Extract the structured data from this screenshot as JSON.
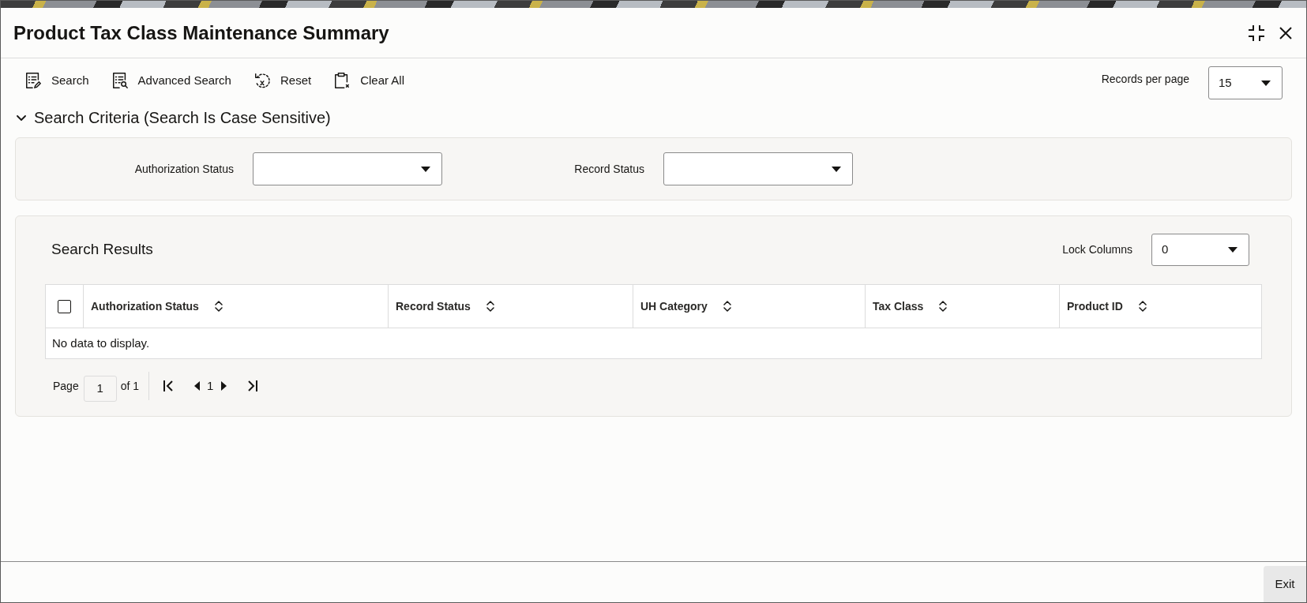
{
  "window": {
    "title": "Product Tax Class Maintenance Summary"
  },
  "toolbar": {
    "buttons": [
      {
        "kind": "search",
        "label": "Search"
      },
      {
        "kind": "advanced_search",
        "label": "Advanced Search"
      },
      {
        "kind": "reset",
        "label": "Reset"
      },
      {
        "kind": "clear_all",
        "label": "Clear All"
      }
    ],
    "records_per_page": {
      "label": "Records per page",
      "value": "15"
    }
  },
  "search_criteria": {
    "title": "Search Criteria (Search Is Case Sensitive)",
    "expanded": true,
    "fields": [
      {
        "label": "Authorization Status"
      },
      {
        "label": "Record Status"
      }
    ]
  },
  "search_results": {
    "title": "Search Results",
    "lock_columns": {
      "label": "Lock Columns",
      "value": "0"
    },
    "table": {
      "select_all_checked": false,
      "columns": [
        "Authorization Status",
        "Record Status",
        "UH Category",
        "Tax Class",
        "Product ID"
      ],
      "empty_message": "No data to display."
    },
    "pagination": {
      "page_label": "Page",
      "page": "1",
      "of_label": "of 1",
      "current": "1"
    }
  },
  "footer": {
    "buttons": [
      "Exit"
    ]
  }
}
